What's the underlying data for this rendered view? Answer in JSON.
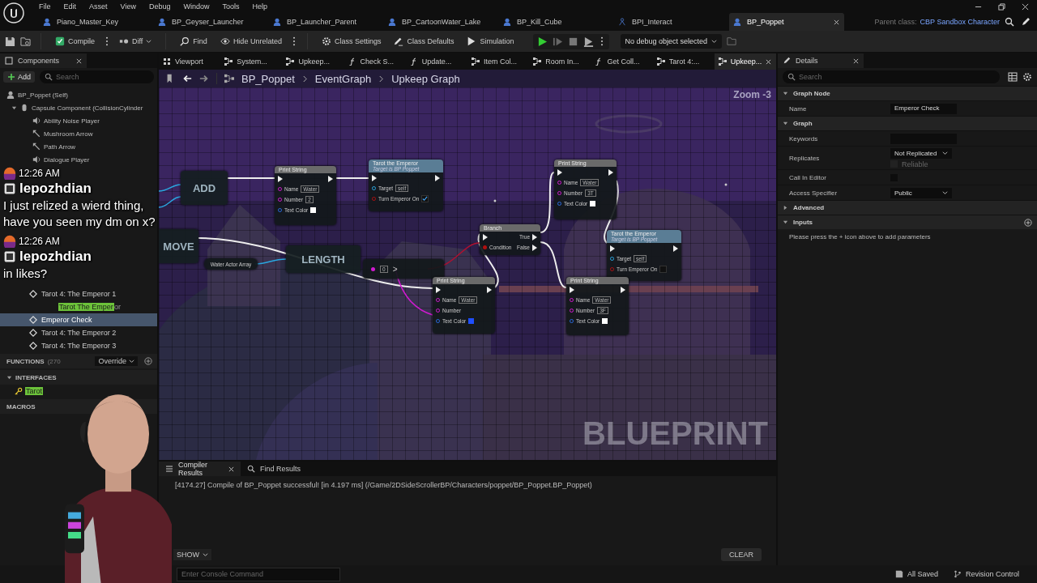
{
  "menu": [
    "File",
    "Edit",
    "Asset",
    "View",
    "Debug",
    "Window",
    "Tools",
    "Help"
  ],
  "asset_tabs": [
    {
      "label": "Piano_Master_Key",
      "kind": "blueprint",
      "selected": false
    },
    {
      "label": "BP_Geyser_Launcher",
      "kind": "blueprint",
      "selected": false
    },
    {
      "label": "BP_Launcher_Parent",
      "kind": "blueprint",
      "selected": false
    },
    {
      "label": "BP_CartoonWater_Lake",
      "kind": "blueprint",
      "selected": false
    },
    {
      "label": "BP_Kill_Cube",
      "kind": "blueprint",
      "selected": false
    },
    {
      "label": "BPI_Interact",
      "kind": "interface",
      "selected": false
    },
    {
      "label": "BP_Poppet",
      "kind": "blueprint",
      "selected": true
    }
  ],
  "parent_class": {
    "label": "Parent class:",
    "value": "CBP Sandbox Character"
  },
  "toolbar": {
    "buttons": [
      {
        "label": "Compile",
        "kind": "compile"
      },
      {
        "label": "Diff",
        "kind": "diff"
      },
      {
        "label": "Find",
        "kind": "find"
      },
      {
        "label": "Hide Unrelated",
        "kind": "hide"
      },
      {
        "label": "Class Settings",
        "kind": "settings"
      },
      {
        "label": "Class Defaults",
        "kind": "defaults"
      },
      {
        "label": "Simulation",
        "kind": "simulation"
      }
    ],
    "debug_object": "No debug object selected"
  },
  "components": {
    "title": "Components",
    "add": "Add",
    "search_placeholder": "Search",
    "tree": [
      {
        "label": "BP_Poppet (Self)",
        "kind": "self",
        "children": [
          {
            "label": "Capsule Component (CollisionCylinder",
            "kind": "capsule",
            "children": [
              {
                "label": "Ability Noise Player",
                "kind": "audio"
              },
              {
                "label": "Mushroom Arrow",
                "kind": "arrow"
              },
              {
                "label": "Path Arrow",
                "kind": "arrow"
              },
              {
                "label": "Dialogue Player",
                "kind": "audio"
              }
            ]
          }
        ]
      }
    ]
  },
  "chat": [
    {
      "time": "12:26 AM",
      "user": "lepozhdian",
      "text": "I just relized a wierd thing, have you seen my dm on x?"
    },
    {
      "time": "12:26 AM",
      "user": "lepozhdian",
      "text": "in likes?"
    }
  ],
  "my_blueprint": {
    "graphs": [
      {
        "label": "Tarot 4: The Emperor 1",
        "kind": "graph",
        "selected": false
      },
      {
        "kind": "match",
        "match": "Tarot The Emper",
        "rest": "or",
        "selected": false
      },
      {
        "label": "Emperor Check",
        "kind": "graph",
        "selected": true
      },
      {
        "label": "Tarot 4: The Emperor 2",
        "kind": "graph",
        "selected": false
      },
      {
        "label": "Tarot 4: The Emperor 3",
        "kind": "graph",
        "selected": false
      }
    ],
    "functions": {
      "label": "FUNCTIONS",
      "count": "(270",
      "override": "Override"
    },
    "interfaces": {
      "label": "INTERFACES",
      "items": [
        {
          "match": "Tarot"
        }
      ]
    },
    "macros": {
      "label": "MACROS"
    }
  },
  "doc_tabs": [
    {
      "label": "Viewport",
      "kind": "viewport",
      "selected": false
    },
    {
      "label": "System...",
      "kind": "graph",
      "selected": false
    },
    {
      "label": "Upkeep...",
      "kind": "graph",
      "selected": false
    },
    {
      "label": "Check S...",
      "kind": "function",
      "selected": false
    },
    {
      "label": "Update...",
      "kind": "function",
      "selected": false
    },
    {
      "label": "Item Col...",
      "kind": "graph",
      "selected": false
    },
    {
      "label": "Room In...",
      "kind": "graph",
      "selected": false
    },
    {
      "label": "Get Coll...",
      "kind": "function",
      "selected": false
    },
    {
      "label": "Tarot 4:...",
      "kind": "graph",
      "selected": false
    },
    {
      "label": "Upkeep...",
      "kind": "graph",
      "selected": true
    }
  ],
  "breadcrumb": [
    "BP_Poppet",
    "EventGraph",
    "Upkeep Graph"
  ],
  "graph": {
    "zoom": "Zoom -3",
    "watermark": "BLUEPRINT",
    "nodes": [
      {
        "kind": "compact",
        "title": "ADD"
      },
      {
        "kind": "compact",
        "title": "MOVE"
      },
      {
        "kind": "function",
        "title": "Print String",
        "pins": [
          {
            "label": "Name",
            "kind": "text",
            "value": "Water"
          },
          {
            "label": "Number",
            "kind": "text",
            "value": "2"
          },
          {
            "label": "Text Color",
            "kind": "color",
            "color": "#ffffff"
          }
        ]
      },
      {
        "kind": "call",
        "title": "Tarot the Emperor",
        "subtitle": "Target is BP Poppet",
        "pins": [
          {
            "label": "Target",
            "kind": "object",
            "value": "self"
          },
          {
            "label": "Turn Emperor On",
            "kind": "check",
            "checked": true
          }
        ]
      },
      {
        "kind": "variable",
        "title": "Water Actor Array"
      },
      {
        "kind": "compact",
        "title": "LENGTH"
      },
      {
        "kind": "compare",
        "op": ">",
        "value": "0"
      },
      {
        "kind": "branch",
        "title": "Branch",
        "outputs": [
          "True",
          "False"
        ],
        "input": "Condition"
      },
      {
        "kind": "function",
        "title": "Print String",
        "pins": [
          {
            "label": "Name",
            "kind": "text",
            "value": "Water"
          },
          {
            "label": "Number",
            "kind": "text",
            "value": "3T"
          },
          {
            "label": "Text Color",
            "kind": "color",
            "color": "#ffffff"
          }
        ]
      },
      {
        "kind": "call",
        "title": "Tarot the Emperor",
        "subtitle": "Target is BP Poppet",
        "pins": [
          {
            "label": "Target",
            "kind": "object",
            "value": "self"
          },
          {
            "label": "Turn Emperor On",
            "kind": "check",
            "checked": false
          }
        ]
      },
      {
        "kind": "function",
        "title": "Print String",
        "pins": [
          {
            "label": "Name",
            "kind": "text",
            "value": "Water"
          },
          {
            "label": "Number",
            "kind": "plain"
          },
          {
            "label": "Text Color",
            "kind": "color",
            "color": "#1f4fff"
          }
        ]
      },
      {
        "kind": "function",
        "title": "Print String",
        "pins": [
          {
            "label": "Name",
            "kind": "text",
            "value": "Water"
          },
          {
            "label": "Number",
            "kind": "text",
            "value": "3F"
          },
          {
            "label": "Text Color",
            "kind": "color",
            "color": "#ffffff"
          }
        ]
      }
    ]
  },
  "compiler": {
    "tabs": [
      {
        "label": "Compiler Results",
        "selected": true
      },
      {
        "label": "Find Results",
        "selected": false
      }
    ],
    "log": "[4174.27] Compile of BP_Poppet successful! [in 4.197 ms] (/Game/2DSideScrollerBP/Characters/poppet/BP_Poppet.BP_Poppet)",
    "show": "SHOW",
    "clear": "CLEAR"
  },
  "details": {
    "title": "Details",
    "search_placeholder": "Search",
    "sections": [
      {
        "title": "Graph Node",
        "expanded": true,
        "rows": [
          {
            "label": "Name",
            "kind": "field",
            "value": "Emperor Check"
          }
        ]
      },
      {
        "title": "Graph",
        "expanded": true,
        "rows": [
          {
            "label": "Keywords",
            "kind": "field"
          },
          {
            "label": "Replicates",
            "kind": "dropdown",
            "value": "Not Replicated",
            "sub": {
              "label": "Reliable",
              "checked": false,
              "disabled": true
            }
          },
          {
            "label": "Call In Editor",
            "kind": "checkbox",
            "checked": false
          },
          {
            "label": "Access Specifier",
            "kind": "dropdown",
            "value": "Public"
          }
        ]
      },
      {
        "title": "Advanced",
        "expanded": false
      },
      {
        "title": "Inputs",
        "expanded": true,
        "add": true,
        "note": "Please press the + icon above to add parameters"
      }
    ]
  },
  "status_bar": {
    "console_placeholder": "Enter Console Command",
    "saved": "All Saved",
    "revision": "Revision Control"
  }
}
